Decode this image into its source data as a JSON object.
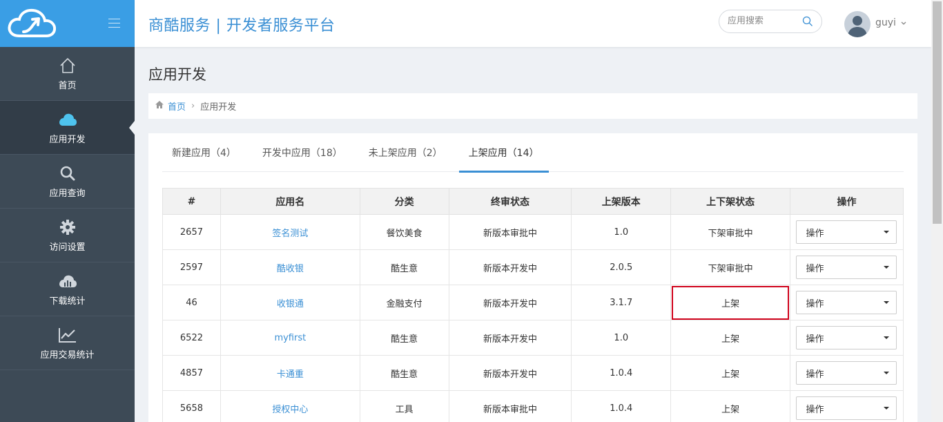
{
  "brand": {
    "accent": "#3a9ee5",
    "link": "#3a8fd4",
    "highlight": "#d0021b"
  },
  "sidebar": {
    "logo_icon": "cloud-logo-icon",
    "menu_icon": "hamburger-icon",
    "items": [
      {
        "label": "首页",
        "icon": "home-icon"
      },
      {
        "label": "应用开发",
        "icon": "cloud-icon"
      },
      {
        "label": "应用查询",
        "icon": "search-icon"
      },
      {
        "label": "访问设置",
        "icon": "gear-icon"
      },
      {
        "label": "下载统计",
        "icon": "cloud-chart-icon"
      },
      {
        "label": "应用交易统计",
        "icon": "line-chart-icon"
      }
    ]
  },
  "header": {
    "title": "商酷服务 | 开发者服务平台",
    "search_placeholder": "应用搜索",
    "username": "guyi"
  },
  "page": {
    "heading": "应用开发",
    "breadcrumb": {
      "home": "首页",
      "current": "应用开发"
    }
  },
  "tabs": [
    {
      "label": "新建应用（4）"
    },
    {
      "label": "开发中应用（18）"
    },
    {
      "label": "未上架应用（2）"
    },
    {
      "label": "上架应用（14）"
    }
  ],
  "table": {
    "headers": [
      "#",
      "应用名",
      "分类",
      "终审状态",
      "上架版本",
      "上下架状态",
      "操作"
    ],
    "rows": [
      {
        "id": "2657",
        "name": "签名测试",
        "category": "餐饮美食",
        "review": "新版本审批中",
        "version": "1.0",
        "status": "下架审批中",
        "action": "操作"
      },
      {
        "id": "2597",
        "name": "酷收银",
        "category": "酷生意",
        "review": "新版本开发中",
        "version": "2.0.5",
        "status": "下架审批中",
        "action": "操作"
      },
      {
        "id": "46",
        "name": "收银通",
        "category": "金融支付",
        "review": "新版本开发中",
        "version": "3.1.7",
        "status": "上架",
        "action": "操作"
      },
      {
        "id": "6522",
        "name": "myfirst",
        "category": "酷生意",
        "review": "新版本开发中",
        "version": "1.0",
        "status": "上架",
        "action": "操作"
      },
      {
        "id": "4857",
        "name": "卡通重",
        "category": "酷生意",
        "review": "新版本开发中",
        "version": "1.0.4",
        "status": "上架",
        "action": "操作"
      },
      {
        "id": "5658",
        "name": "授权中心",
        "category": "工具",
        "review": "新版本审批中",
        "version": "1.0.4",
        "status": "上架",
        "action": "操作"
      }
    ]
  }
}
